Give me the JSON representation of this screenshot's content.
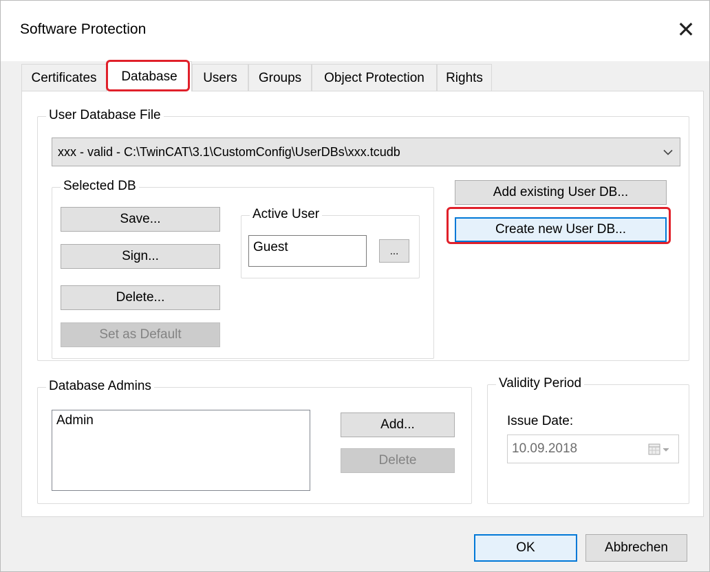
{
  "window": {
    "title": "Software Protection",
    "close_glyph": "✕"
  },
  "tabs": [
    {
      "label": "Certificates"
    },
    {
      "label": "Database"
    },
    {
      "label": "Users"
    },
    {
      "label": "Groups"
    },
    {
      "label": "Object Protection"
    },
    {
      "label": "Rights"
    }
  ],
  "active_tab": "Database",
  "user_db_file": {
    "legend": "User Database File",
    "selected_value": "xxx - valid - C:\\TwinCAT\\3.1\\CustomConfig\\UserDBs\\xxx.tcudb"
  },
  "selected_db": {
    "legend": "Selected DB",
    "save_label": "Save...",
    "sign_label": "Sign...",
    "delete_label": "Delete...",
    "set_default_label": "Set as Default"
  },
  "active_user": {
    "legend": "Active User",
    "value": "Guest",
    "browse_label": "..."
  },
  "db_actions": {
    "add_existing_label": "Add existing User DB...",
    "create_new_label": "Create new User DB..."
  },
  "database_admins": {
    "legend": "Database Admins",
    "items": [
      "Admin"
    ],
    "add_label": "Add...",
    "delete_label": "Delete"
  },
  "validity": {
    "legend": "Validity Period",
    "issue_date_label": "Issue Date:",
    "issue_date_value": "10.09.2018"
  },
  "footer": {
    "ok_label": "OK",
    "cancel_label": "Abbrechen"
  },
  "colors": {
    "highlight": "#e0202a",
    "focus": "#0078d7"
  }
}
